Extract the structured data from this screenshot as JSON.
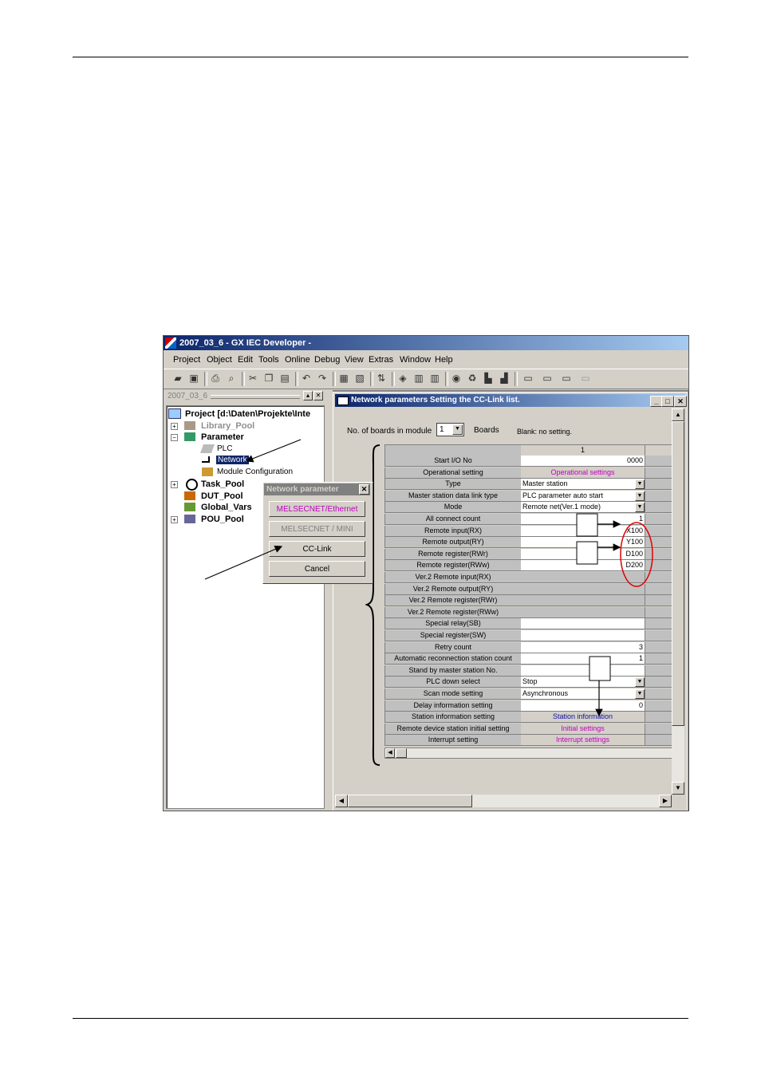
{
  "app": {
    "title": "2007_03_6 - GX IEC Developer -",
    "menu": [
      "Project",
      "Object",
      "Edit",
      "Tools",
      "Online",
      "Debug",
      "View",
      "Extras",
      "Window",
      "Help"
    ]
  },
  "tree": {
    "header": "2007_03_6",
    "items": [
      {
        "label": "Project [d:\\Daten\\Projekte\\Inte",
        "bold": true
      },
      {
        "label": "Library_Pool",
        "bold": true,
        "grey": true
      },
      {
        "label": "Parameter",
        "bold": true
      },
      {
        "label": "PLC"
      },
      {
        "label": "Network",
        "selected": true
      },
      {
        "label": "Module Configuration"
      },
      {
        "label": "Task_Pool",
        "bold": true
      },
      {
        "label": "DUT_Pool",
        "bold": true
      },
      {
        "label": "Global_Vars",
        "bold": true
      },
      {
        "label": "POU_Pool",
        "bold": true
      }
    ]
  },
  "popup": {
    "title": "Network parameter",
    "buttons": [
      "MELSECNET/Ethernet",
      "MELSECNET / MINI",
      "CC-Link",
      "Cancel"
    ]
  },
  "child": {
    "title": "Network parameters  Setting the CC-Link list.",
    "boards_label": "No. of boards in module",
    "boards_value": "1",
    "boards_unit": "Boards",
    "blank_note": "Blank: no setting.",
    "column_header": "1",
    "rows": [
      {
        "label": "Start I/O No",
        "value": "0000",
        "style": "r"
      },
      {
        "label": "Operational setting",
        "value": "Operational settings",
        "style": "pink"
      },
      {
        "label": "Type",
        "value": "Master station",
        "style": "l",
        "dropdown": true
      },
      {
        "label": "Master station data link type",
        "value": "PLC parameter auto start",
        "style": "l",
        "dropdown": true
      },
      {
        "label": "Mode",
        "value": "Remote net(Ver.1 mode)",
        "style": "l",
        "dropdown": true
      },
      {
        "label": "All connect count",
        "value": "1",
        "style": "r"
      },
      {
        "label": "Remote input(RX)",
        "value": "X100",
        "style": "r"
      },
      {
        "label": "Remote output(RY)",
        "value": "Y100",
        "style": "r"
      },
      {
        "label": "Remote register(RWr)",
        "value": "D100",
        "style": "r"
      },
      {
        "label": "Remote register(RWw)",
        "value": "D200",
        "style": "r"
      },
      {
        "label": "Ver.2 Remote input(RX)",
        "value": "",
        "style": "g"
      },
      {
        "label": "Ver.2 Remote output(RY)",
        "value": "",
        "style": "g"
      },
      {
        "label": "Ver.2 Remote register(RWr)",
        "value": "",
        "style": "g"
      },
      {
        "label": "Ver.2 Remote register(RWw)",
        "value": "",
        "style": "g"
      },
      {
        "label": "Special relay(SB)",
        "value": "",
        "style": "r"
      },
      {
        "label": "Special register(SW)",
        "value": "",
        "style": "r"
      },
      {
        "label": "Retry count",
        "value": "3",
        "style": "r"
      },
      {
        "label": "Automatic reconnection station count",
        "value": "1",
        "style": "r"
      },
      {
        "label": "Stand by master station No.",
        "value": "",
        "style": "r"
      },
      {
        "label": "PLC down select",
        "value": "Stop",
        "style": "l",
        "dropdown": true
      },
      {
        "label": "Scan mode setting",
        "value": "Asynchronous",
        "style": "l",
        "dropdown": true
      },
      {
        "label": "Delay information setting",
        "value": "0",
        "style": "r"
      },
      {
        "label": "Station information setting",
        "value": "Station information",
        "style": "blue"
      },
      {
        "label": "Remote device station initial setting",
        "value": "Initial settings",
        "style": "pink"
      },
      {
        "label": "Interrupt setting",
        "value": "Interrupt settings",
        "style": "pink"
      }
    ]
  },
  "colors": {
    "pink": "#c000c0",
    "blue": "#1010a0",
    "titlebar": "#0a246a",
    "highlight": "#e00000"
  }
}
